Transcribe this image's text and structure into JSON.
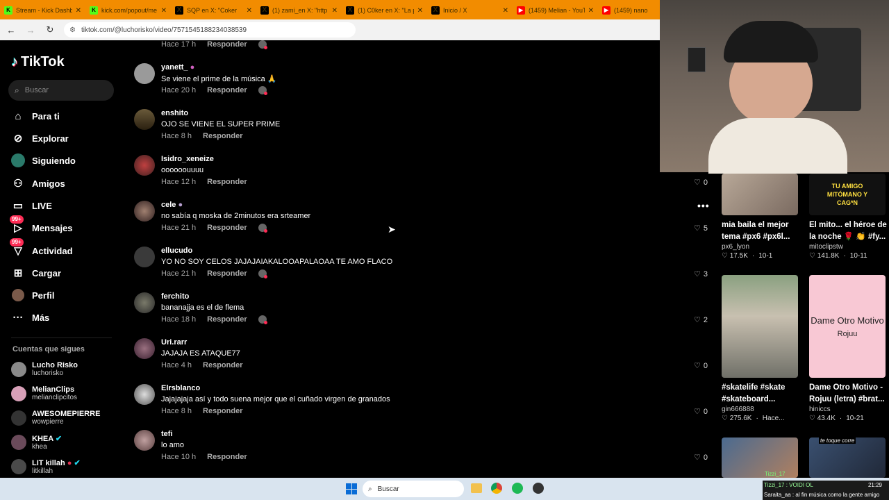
{
  "browser": {
    "tabs": [
      {
        "title": "Stream - Kick Dashbo",
        "icon": "kick"
      },
      {
        "title": "kick.com/popout/me",
        "icon": "kick"
      },
      {
        "title": "SQP en X: \"Coker",
        "icon": "x"
      },
      {
        "title": "(1) zami_en X: \"http",
        "icon": "x"
      },
      {
        "title": "(1) C0ker en X: \"La po",
        "icon": "x"
      },
      {
        "title": "Inicio / X",
        "icon": "x"
      },
      {
        "title": "(1459) Melian - YouT",
        "icon": "yt"
      },
      {
        "title": "(1459) nano",
        "icon": "yt"
      }
    ],
    "url": "tiktok.com/@luchorisko/video/7571545188234038539"
  },
  "sidebar": {
    "logo": "TikTok",
    "search_placeholder": "Buscar",
    "items": [
      {
        "label": "Para ti",
        "icon": "home-icon"
      },
      {
        "label": "Explorar",
        "icon": "compass-icon"
      },
      {
        "label": "Siguiendo",
        "icon": "following-icon"
      },
      {
        "label": "Amigos",
        "icon": "friends-icon"
      },
      {
        "label": "LIVE",
        "icon": "live-icon"
      },
      {
        "label": "Mensajes",
        "icon": "messages-icon",
        "badge": "99+"
      },
      {
        "label": "Actividad",
        "icon": "activity-icon",
        "badge": "99+"
      },
      {
        "label": "Cargar",
        "icon": "upload-icon"
      },
      {
        "label": "Perfil",
        "icon": "profile-icon"
      },
      {
        "label": "Más",
        "icon": "more-icon"
      }
    ],
    "following_heading": "Cuentas que sigues",
    "following": [
      {
        "name": "Lucho Risko",
        "handle": "luchorisko"
      },
      {
        "name": "MelianClips",
        "handle": "melianclipcitos"
      },
      {
        "name": "AWESOMEPIERRE",
        "handle": "wowpierre"
      },
      {
        "name": "KHEA",
        "handle": "khea",
        "verified": true
      },
      {
        "name": "LIT killah",
        "handle": "litkillah",
        "verified": true
      }
    ]
  },
  "comments": {
    "reply_label": "Responder",
    "top_time": "Hace 17 h",
    "items": [
      {
        "user": "yanett_",
        "text": "Se viene el prime de la música 🙏",
        "time": "Hace 20 h",
        "creator_like": true
      },
      {
        "user": "enshito",
        "text": "OJO SE VIENE EL SUPER PRIME",
        "time": "Hace 8 h",
        "creator_like": false
      },
      {
        "user": "Isidro_xeneize",
        "text": "oooooouuuu",
        "time": "Hace 12 h",
        "creator_like": false
      },
      {
        "user": "cele",
        "text": "no sabía q moska de 2minutos era srteamer",
        "time": "Hace 21 h",
        "creator_like": true
      },
      {
        "user": "ellucudo",
        "text": "YO NO SOY CELOS JAJAJAIAKALOOAPALAOAA TE AMO FLACO",
        "time": "Hace 21 h",
        "creator_like": true
      },
      {
        "user": "ferchito",
        "text": "bananajja es el de flema",
        "time": "Hace 18 h",
        "creator_like": true
      },
      {
        "user": "Uri.rarr",
        "text": "JAJAJA ES ATAQUE77",
        "time": "Hace 4 h",
        "creator_like": false
      },
      {
        "user": "Elrsblanco",
        "text": "Jajajajaja así y todo suena mejor que el cuñado virgen de granados",
        "time": "Hace 8 h",
        "creator_like": false
      },
      {
        "user": "tefi",
        "text": "lo amo",
        "time": "Hace 10 h",
        "creator_like": false
      }
    ],
    "likes": [
      "0",
      "5",
      "3",
      "2",
      "0",
      "0",
      "0"
    ]
  },
  "recommended": [
    {
      "title": "mia baila el mejor tema #px6 #px6l...",
      "user": "px6_lyon",
      "likes": "17.5K",
      "date": "10-1"
    },
    {
      "title": "El mito... el héroe de la noche 🌹 👏 #fy...",
      "user": "mitoclipstw",
      "likes": "141.8K",
      "date": "10-11",
      "overlay": "TU AMIGO MITÓMANO Y CAG*N"
    },
    {
      "title": "#skatelife #skate #skateboard...",
      "user": "gin666888",
      "likes": "275.6K",
      "date": "Hace..."
    },
    {
      "title": "Dame Otro Motivo - Rojuu (letra) #brat...",
      "user": "hiniccs",
      "likes": "43.4K",
      "date": "10-21",
      "overlay_title": "Dame Otro Motivo",
      "overlay_sub": "Rojuu"
    },
    {
      "overlay": "Tizzi_17"
    },
    {
      "overlay": "te toque corre"
    }
  ],
  "taskbar": {
    "search": "Buscar",
    "chat_line": "Saraita_aa : al fin música como la gente amigo",
    "chat_user": "Tizzi_17 : VOIDI OL",
    "time": "21:29"
  }
}
